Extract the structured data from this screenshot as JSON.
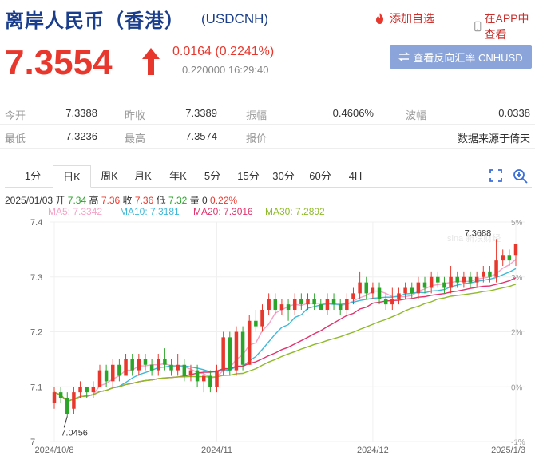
{
  "header": {
    "title": "离岸人民币（香港）",
    "code": "(USDCNH)",
    "add_fav": "添加自选",
    "app_view": "在APP中查看"
  },
  "quote": {
    "price": "7.3554",
    "change": "0.0164 (0.2241%)",
    "subinfo": "0.220000 16:29:40",
    "reverse_btn": "查看反向汇率 CNHUSD",
    "direction": "up"
  },
  "stats": [
    {
      "l1": "今开",
      "v1": "7.3388",
      "l2": "昨收",
      "v2": "7.3389",
      "l3": "振幅",
      "v3": "0.4606%",
      "l4": "波幅",
      "v4": "0.0338"
    },
    {
      "l1": "最低",
      "v1": "7.3236",
      "l2": "最高",
      "v2": "7.3574",
      "l3": "报价",
      "v3": "",
      "l4": "",
      "v4": "数据来源于倚天"
    }
  ],
  "tabs": [
    "1分",
    "日K",
    "周K",
    "月K",
    "年K",
    "5分",
    "15分",
    "30分",
    "60分",
    "4H"
  ],
  "active_tab": "日K",
  "ohlc": {
    "date": "2025/01/03",
    "open_label": "开",
    "open": "7.34",
    "high_label": "高",
    "high": "7.36",
    "close_label": "收",
    "close": "7.36",
    "low_label": "低",
    "low": "7.32",
    "vol_label": "量",
    "vol": "0",
    "pct": "0.22%"
  },
  "ma_legend": [
    {
      "label": "MA5: 7.3342",
      "color": "#f5a3c7"
    },
    {
      "label": "MA10: 7.3181",
      "color": "#3fb8d8"
    },
    {
      "label": "MA20: 7.3016",
      "color": "#e0336e"
    },
    {
      "label": "MA30: 7.2892",
      "color": "#8fba2a"
    }
  ],
  "chart_data": {
    "type": "candlestick",
    "ylim": [
      7.0,
      7.4
    ],
    "y_ticks": [
      "7.4",
      "7.3",
      "7.2",
      "7.1",
      "7"
    ],
    "y_right_ticks": [
      "5%",
      "3%",
      "2%",
      "0%",
      "-1%"
    ],
    "x_ticks": [
      "2024/10/8",
      "2024/11",
      "2024/12",
      "2025/1/3"
    ],
    "max_label": "7.3688",
    "min_label": "7.0456",
    "up_color": "#e8382d",
    "down_color": "#2aa52a",
    "candles": [
      [
        7.07,
        7.09,
        7.06,
        7.1
      ],
      [
        7.09,
        7.08,
        7.07,
        7.1
      ],
      [
        7.08,
        7.05,
        7.046,
        7.09
      ],
      [
        7.06,
        7.09,
        7.05,
        7.1
      ],
      [
        7.09,
        7.1,
        7.08,
        7.11
      ],
      [
        7.1,
        7.09,
        7.08,
        7.1
      ],
      [
        7.09,
        7.1,
        7.08,
        7.11
      ],
      [
        7.1,
        7.13,
        7.1,
        7.14
      ],
      [
        7.13,
        7.11,
        7.1,
        7.14
      ],
      [
        7.11,
        7.14,
        7.1,
        7.15
      ],
      [
        7.14,
        7.12,
        7.11,
        7.15
      ],
      [
        7.12,
        7.15,
        7.12,
        7.16
      ],
      [
        7.15,
        7.13,
        7.12,
        7.16
      ],
      [
        7.13,
        7.15,
        7.12,
        7.16
      ],
      [
        7.15,
        7.14,
        7.13,
        7.16
      ],
      [
        7.14,
        7.13,
        7.12,
        7.15
      ],
      [
        7.13,
        7.15,
        7.12,
        7.16
      ],
      [
        7.15,
        7.14,
        7.13,
        7.17
      ],
      [
        7.14,
        7.13,
        7.12,
        7.15
      ],
      [
        7.13,
        7.14,
        7.12,
        7.16
      ],
      [
        7.14,
        7.12,
        7.11,
        7.15
      ],
      [
        7.12,
        7.13,
        7.11,
        7.14
      ],
      [
        7.13,
        7.11,
        7.1,
        7.14
      ],
      [
        7.11,
        7.12,
        7.09,
        7.13
      ],
      [
        7.12,
        7.1,
        7.09,
        7.13
      ],
      [
        7.1,
        7.13,
        7.09,
        7.14
      ],
      [
        7.13,
        7.19,
        7.12,
        7.2
      ],
      [
        7.19,
        7.13,
        7.12,
        7.2
      ],
      [
        7.13,
        7.2,
        7.12,
        7.21
      ],
      [
        7.2,
        7.14,
        7.13,
        7.21
      ],
      [
        7.14,
        7.22,
        7.14,
        7.23
      ],
      [
        7.22,
        7.21,
        7.2,
        7.24
      ],
      [
        7.21,
        7.24,
        7.2,
        7.25
      ],
      [
        7.24,
        7.26,
        7.23,
        7.27
      ],
      [
        7.26,
        7.24,
        7.23,
        7.27
      ],
      [
        7.24,
        7.25,
        7.23,
        7.26
      ],
      [
        7.25,
        7.24,
        7.22,
        7.26
      ],
      [
        7.24,
        7.26,
        7.23,
        7.27
      ],
      [
        7.26,
        7.25,
        7.24,
        7.27
      ],
      [
        7.25,
        7.26,
        7.24,
        7.27
      ],
      [
        7.26,
        7.25,
        7.24,
        7.27
      ],
      [
        7.25,
        7.24,
        7.24,
        7.26
      ],
      [
        7.24,
        7.26,
        7.23,
        7.27
      ],
      [
        7.26,
        7.25,
        7.24,
        7.27
      ],
      [
        7.25,
        7.24,
        7.23,
        7.26
      ],
      [
        7.24,
        7.26,
        7.23,
        7.27
      ],
      [
        7.26,
        7.27,
        7.25,
        7.28
      ],
      [
        7.27,
        7.29,
        7.26,
        7.31
      ],
      [
        7.29,
        7.27,
        7.26,
        7.3
      ],
      [
        7.27,
        7.28,
        7.26,
        7.29
      ],
      [
        7.28,
        7.26,
        7.25,
        7.29
      ],
      [
        7.26,
        7.25,
        7.24,
        7.27
      ],
      [
        7.25,
        7.26,
        7.24,
        7.28
      ],
      [
        7.26,
        7.27,
        7.25,
        7.28
      ],
      [
        7.27,
        7.28,
        7.26,
        7.29
      ],
      [
        7.28,
        7.27,
        7.26,
        7.29
      ],
      [
        7.27,
        7.29,
        7.26,
        7.3
      ],
      [
        7.29,
        7.28,
        7.27,
        7.3
      ],
      [
        7.28,
        7.3,
        7.27,
        7.31
      ],
      [
        7.3,
        7.29,
        7.28,
        7.31
      ],
      [
        7.29,
        7.28,
        7.27,
        7.3
      ],
      [
        7.28,
        7.3,
        7.27,
        7.32
      ],
      [
        7.3,
        7.29,
        7.28,
        7.31
      ],
      [
        7.29,
        7.3,
        7.28,
        7.31
      ],
      [
        7.3,
        7.29,
        7.28,
        7.31
      ],
      [
        7.29,
        7.3,
        7.28,
        7.31
      ],
      [
        7.3,
        7.31,
        7.29,
        7.32
      ],
      [
        7.31,
        7.3,
        7.29,
        7.32
      ],
      [
        7.3,
        7.33,
        7.29,
        7.369
      ],
      [
        7.33,
        7.34,
        7.32,
        7.35
      ],
      [
        7.34,
        7.33,
        7.32,
        7.35
      ],
      [
        7.34,
        7.36,
        7.32,
        7.36
      ]
    ]
  }
}
